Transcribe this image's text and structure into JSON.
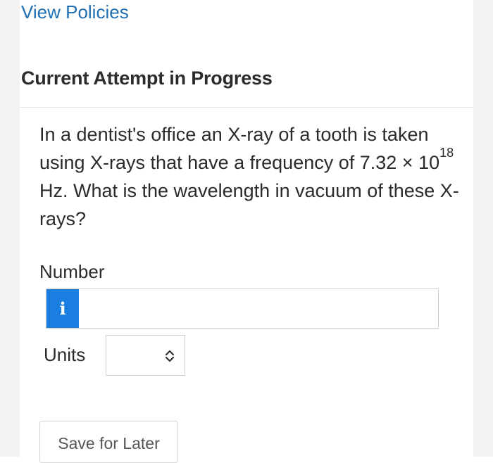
{
  "header": {
    "policies_link": "View Policies",
    "section_title": "Current Attempt in Progress"
  },
  "question": {
    "text_before": "In a dentist's office an X-ray of a tooth is taken using X-rays that have a frequency of 7.32 × 10",
    "exponent": "18",
    "text_after": " Hz. What is the wavelength in vacuum of these X-rays?"
  },
  "answer": {
    "number_label": "Number",
    "info_icon": "i",
    "number_value": "",
    "units_label": "Units",
    "units_value": ""
  },
  "actions": {
    "save_label": "Save for Later"
  },
  "colors": {
    "link": "#1f6fb2",
    "info_badge": "#1a7de0",
    "text": "#2b2b2b"
  }
}
